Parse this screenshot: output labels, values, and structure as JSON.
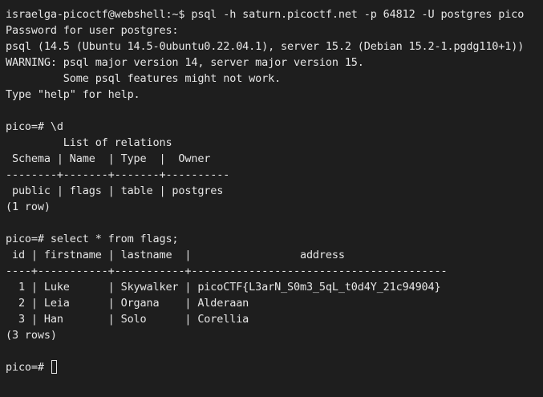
{
  "terminal": {
    "lines": [
      "israelga-picoctf@webshell:~$ psql -h saturn.picoctf.net -p 64812 -U postgres pico",
      "Password for user postgres:",
      "psql (14.5 (Ubuntu 14.5-0ubuntu0.22.04.1), server 15.2 (Debian 15.2-1.pgdg110+1))",
      "WARNING: psql major version 14, server major version 15.",
      "         Some psql features might not work.",
      "Type \"help\" for help.",
      "",
      "pico=# \\d",
      "         List of relations",
      " Schema | Name  | Type  |  Owner",
      "--------+-------+-------+----------",
      " public | flags | table | postgres",
      "(1 row)",
      "",
      "pico=# select * from flags;",
      " id | firstname | lastname  |                 address",
      "----+-----------+-----------+----------------------------------------",
      "  1 | Luke      | Skywalker | picoCTF{L3arN_S0m3_5qL_t0d4Y_21c94904}",
      "  2 | Leia      | Organa    | Alderaan",
      "  3 | Han       | Solo      | Corellia",
      "(3 rows)",
      ""
    ],
    "prompt": "pico=# "
  },
  "colors": {
    "background": "#1e1e1e",
    "foreground": "#e6e6e6"
  }
}
